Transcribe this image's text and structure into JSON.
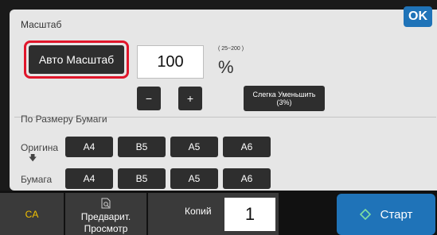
{
  "header": {
    "title": "Масштаб",
    "ok_label": "OK"
  },
  "zoom": {
    "auto_label": "Авто Масштаб",
    "value": "100",
    "range": "( 25~200 )",
    "unit": "%",
    "minus_label": "−",
    "plus_label": "+",
    "slight_reduce_line1": "Слегка Уменьшить",
    "slight_reduce_line2": "(3%)"
  },
  "paper_section": {
    "title": "По Размеру Бумаги",
    "original_label": "Оригина",
    "paper_label": "Бумага",
    "original_sizes": [
      "A4",
      "B5",
      "A5",
      "A6"
    ],
    "paper_sizes": [
      "A4",
      "B5",
      "A5",
      "A6"
    ]
  },
  "bottom_bar": {
    "ca_label": "CA",
    "preview_line1": "Предварит.",
    "preview_line2": "Просмотр",
    "copies_label": "Копий",
    "copies_value": "1",
    "start_label": "Старт"
  },
  "colors": {
    "accent": "#1f73b8",
    "highlight": "#e0162b",
    "ca_text": "#f3c200"
  }
}
